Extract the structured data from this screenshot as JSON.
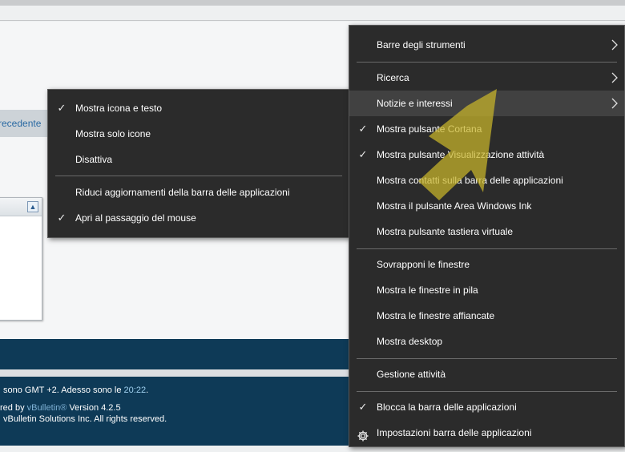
{
  "page": {
    "prev_link": "recedente",
    "box_collapse_glyph": "▲",
    "footer": {
      "line1_prefix": "sono GMT +2. Adesso sono le ",
      "line1_time": "20:22",
      "line1_suffix": ".",
      "line2_prefix": "red by ",
      "line2_link": "vBulletin®",
      "line2_suffix": " Version 4.2.5",
      "line3": "vBulletin Solutions Inc. All rights reserved."
    },
    "colors": {
      "footer_bg": "#0e3a57",
      "link": "#7fb2d6",
      "menu_bg": "#2b2b2b",
      "menu_hover": "#414141",
      "annotation_arrow": "#c9b52a"
    }
  },
  "taskbar_menu": {
    "items": [
      {
        "label": "Barre degli strumenti",
        "checked": false,
        "submenu": true
      },
      {
        "label": "Ricerca",
        "checked": false,
        "submenu": true
      },
      {
        "label": "Notizie e interessi",
        "checked": false,
        "submenu": true,
        "highlighted": true
      },
      {
        "label": "Mostra pulsante Cortana",
        "checked": true
      },
      {
        "label": "Mostra pulsante Visualizzazione attività",
        "checked": true
      },
      {
        "label": "Mostra contatti sulla barra delle applicazioni",
        "checked": false
      },
      {
        "label": "Mostra il pulsante Area Windows Ink",
        "checked": false
      },
      {
        "label": "Mostra pulsante tastiera virtuale",
        "checked": false
      },
      {
        "label": "Sovrapponi le finestre",
        "checked": false
      },
      {
        "label": "Mostra le finestre in pila",
        "checked": false
      },
      {
        "label": "Mostra le finestre affiancate",
        "checked": false
      },
      {
        "label": "Mostra desktop",
        "checked": false
      },
      {
        "label": "Gestione attività",
        "checked": false
      },
      {
        "label": "Blocca la barra delle applicazioni",
        "checked": true
      },
      {
        "label": "Impostazioni barra delle applicazioni",
        "icon": "gear-icon"
      }
    ]
  },
  "news_submenu": {
    "items": [
      {
        "label": "Mostra icona e testo",
        "checked": true
      },
      {
        "label": "Mostra solo icone",
        "checked": false
      },
      {
        "label": "Disattiva",
        "checked": false
      },
      {
        "label": "Riduci aggiornamenti della barra delle applicazioni",
        "checked": false
      },
      {
        "label": "Apri al passaggio del mouse",
        "checked": true
      }
    ]
  },
  "glyphs": {
    "check": "✓",
    "chevron": "〉"
  }
}
